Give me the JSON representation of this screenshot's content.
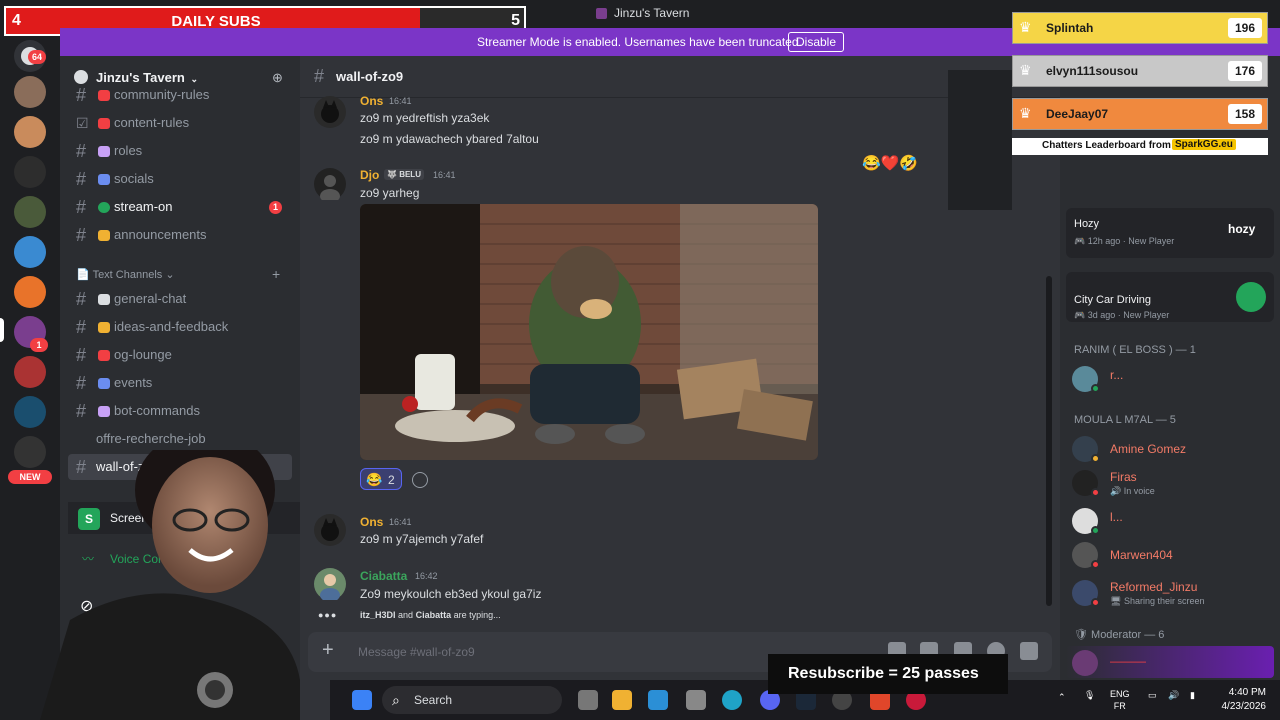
{
  "window": {
    "title": "Jinzu's Tavern"
  },
  "daily_subs": {
    "left_count": "4",
    "label": "DAILY SUBS",
    "right_count": "5",
    "progress": 0.8
  },
  "banner": {
    "text": "Streamer Mode is enabled. Usernames have been truncated.",
    "button": "Disable"
  },
  "rail": {
    "unread_badge": "64",
    "dm_badge": "1",
    "new_badge": "NEW"
  },
  "server": {
    "name": "Jinzu's Tavern"
  },
  "channels": [
    {
      "label": "community-rules",
      "icon": "hash"
    },
    {
      "label": "content-rules",
      "icon": "rules-box"
    },
    {
      "label": "roles",
      "icon": "hash"
    },
    {
      "label": "socials",
      "icon": "hash"
    },
    {
      "label": "stream-on",
      "icon": "hash",
      "badge": "1"
    },
    {
      "label": "announcements",
      "icon": "hash"
    }
  ],
  "category": {
    "label": "Text Channels"
  },
  "text_channels": [
    {
      "label": "general-chat"
    },
    {
      "label": "ideas-and-feedback"
    },
    {
      "label": "og-lounge"
    },
    {
      "label": "events"
    },
    {
      "label": "bot-commands"
    },
    {
      "label": "offre-recherche-job"
    },
    {
      "label": "wall-of-zo9"
    }
  ],
  "screen_share": {
    "label": "Screen 1"
  },
  "voice": {
    "label": "Voice Connected"
  },
  "chat": {
    "channel": "wall-of-zo9",
    "messages": [
      {
        "author": "Ons",
        "time": "16:41",
        "lines": [
          "zo9 m yedreftish yza3ek",
          "zo9 m ydawachech ybared 7altou"
        ],
        "color": "#f0b132"
      },
      {
        "author": "Djo",
        "tag": "BELU",
        "time": "16:41",
        "lines": [
          "zo9 yarheg"
        ],
        "color": "#f0b132"
      },
      {
        "author": "Ons",
        "time": "16:41",
        "lines": [
          "zo9 m y7ajemch y7afef"
        ],
        "color": "#f0b132"
      },
      {
        "author": "Ciabatta",
        "time": "16:42",
        "lines": [
          "Zo9 meykoulch eb3ed ykoul ga7iz"
        ],
        "color": "#3ba55c"
      }
    ],
    "reaction": {
      "emoji": "😂",
      "count": "2"
    },
    "quick_reactions": "😂❤️🤣",
    "typing": {
      "user1": "itz_H3DI",
      "and": "and",
      "user2": "Ciabatta",
      "suffix": "are typing..."
    },
    "input_placeholder": "Message #wall-of-zo9"
  },
  "leaderboard": {
    "rows": [
      {
        "name": "Splintah",
        "value": "196",
        "bg": "#f5d546"
      },
      {
        "name": "elvyn111sousou",
        "value": "176",
        "bg": "#c8c8c8"
      },
      {
        "name": "DeeJaay07",
        "value": "158",
        "bg": "#f0893e"
      }
    ],
    "footer": "Chatters Leaderboard from",
    "source": "SparkGG.eu"
  },
  "activities": [
    {
      "name": "Hozy",
      "time": "12h ago",
      "meta": "New Player",
      "brand": "hozy"
    },
    {
      "name": "City Car Driving",
      "time": "3d ago",
      "meta": "New Player"
    }
  ],
  "member_groups": [
    {
      "label": "RANIM ( EL BOSS ) — 1",
      "members": [
        {
          "name": "r...",
          "color": "#f47b67"
        }
      ]
    },
    {
      "label": "MOULA L M7AL — 5",
      "members": [
        {
          "name": "Amine Gomez",
          "color": "#f47b67"
        },
        {
          "name": "Firas",
          "sub": "In voice",
          "color": "#f47b67"
        },
        {
          "name": "l...",
          "color": "#f47b67"
        },
        {
          "name": "Marwen404",
          "color": "#f47b67"
        },
        {
          "name": "Reformed_Jinzu",
          "sub": "Sharing their screen",
          "color": "#f47b67"
        }
      ]
    },
    {
      "label": "Moderator — 6",
      "members": []
    }
  ],
  "resub": {
    "text": "Resubscribe = 25 passes"
  },
  "taskbar": {
    "search": "Search",
    "lang": "ENG",
    "region": "FR",
    "time": "4:40 PM",
    "date": "4/23/2026"
  }
}
